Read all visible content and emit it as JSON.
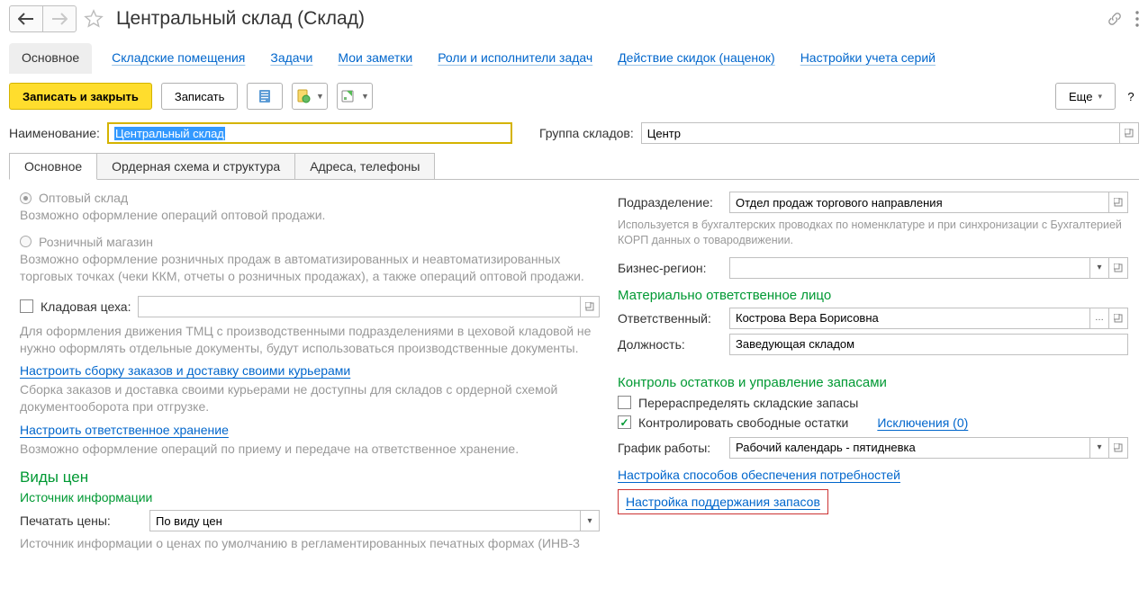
{
  "header": {
    "title": "Центральный склад (Склад)"
  },
  "nav": {
    "tabs": [
      "Основное",
      "Складские помещения",
      "Задачи",
      "Мои заметки",
      "Роли и исполнители задач",
      "Действие скидок (наценок)",
      "Настройки учета серий"
    ]
  },
  "actions": {
    "save_close": "Записать и закрыть",
    "save": "Записать",
    "more": "Еще"
  },
  "top_fields": {
    "name_label": "Наименование:",
    "name_value": "Центральный склад",
    "group_label": "Группа складов:",
    "group_value": "Центр"
  },
  "inner_tabs": [
    "Основное",
    "Ордерная схема и структура",
    "Адреса, телефоны"
  ],
  "left": {
    "radio1": "Оптовый склад",
    "radio1_help": "Возможно оформление операций оптовой продажи.",
    "radio2": "Розничный магазин",
    "radio2_help": "Возможно оформление розничных продаж в автоматизированных и неавтоматизированных торговых точках (чеки ККМ, отчеты о розничных продажах), а также операций оптовой продажи.",
    "workshop_label": "Кладовая цеха:",
    "workshop_help": "Для оформления движения ТМЦ с производственными подразделениями в цеховой кладовой не нужно оформлять отдельные документы, будут использоваться производственные документы.",
    "link_courier": "Настроить сборку заказов и доставку своими курьерами",
    "courier_help": "Сборка заказов и доставка своими курьерами не доступны для складов с ордерной схемой документооборота при отгрузке.",
    "link_custody": "Настроить ответственное хранение",
    "custody_help": "Возможно оформление операций по приему и передаче на ответственное хранение.",
    "prices_heading": "Виды цен",
    "prices_source": "Источник информации",
    "print_label": "Печатать цены:",
    "print_value": "По виду цен",
    "truncated": "Источник информации о ценах по умолчанию в регламентированных печатных формах (ИНВ-3"
  },
  "right": {
    "dept_label": "Подразделение:",
    "dept_value": "Отдел продаж торгового направления",
    "dept_help": "Используется в бухгалтерских проводках по номенклатуре и при синхронизации с Бухгалтерией КОРП данных о товародвижении.",
    "region_label": "Бизнес-регион:",
    "resp_heading": "Материально ответственное лицо",
    "resp_label": "Ответственный:",
    "resp_value": "Кострова Вера Борисовна",
    "pos_label": "Должность:",
    "pos_value": "Заведующая складом",
    "stock_heading": "Контроль остатков и управление запасами",
    "chk_redistribute": "Перераспределять складские запасы",
    "chk_control": "Контролировать свободные остатки",
    "link_exceptions": "Исключения (0)",
    "schedule_label": "График работы:",
    "schedule_value": "Рабочий календарь - пятидневка",
    "link_supply": "Настройка способов обеспечения потребностей",
    "link_maintain": "Настройка поддержания запасов"
  }
}
